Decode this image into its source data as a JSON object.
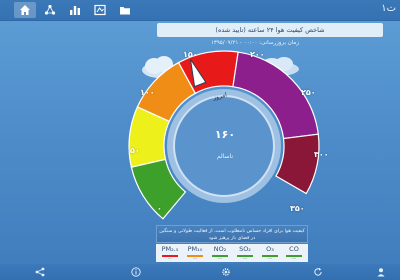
{
  "header": {
    "tabs": [
      {
        "icon": "home-icon",
        "active": true
      },
      {
        "icon": "network-icon",
        "active": false
      },
      {
        "icon": "bar-chart-icon",
        "active": false
      },
      {
        "icon": "map-icon",
        "active": false
      },
      {
        "icon": "folder-icon",
        "active": false
      }
    ],
    "menu_label": "ت۱"
  },
  "gauge": {
    "title": "شاخص کیفیت هوا ۲۴ ساعته (تایید شده)",
    "time_text": "زمان بروزرسانی: ۰۰:۰۰ - ۱۳۹۵/۰۹/۲۱",
    "ticks": [
      "۰",
      "۵۰",
      "۱۰۰",
      "۱۵۰",
      "۲۰۰",
      "۲۵۰",
      "۳۰۰",
      "۳۵۰"
    ],
    "today_label": "امروز",
    "value": "۱۶۰",
    "value_number": 160,
    "status": "ناسالم",
    "segment_colors": [
      "#3da02a",
      "#eef01c",
      "#ef8d16",
      "#e81919",
      "#8c1f8c",
      "#8a1737"
    ]
  },
  "info_text": "کیفیت هوا برای افراد حساس نامطلوب است، از فعالیت طولانی و سنگین در فضای باز پرهیز شود",
  "pollutants": [
    {
      "name": "PM₂.₅",
      "color": "#e81919",
      "value": "---"
    },
    {
      "name": "PM₁₀",
      "color": "#ef8d16",
      "value": "---"
    },
    {
      "name": "NO₂",
      "color": "#3da02a",
      "value": "---"
    },
    {
      "name": "SO₂",
      "color": "#3da02a",
      "value": "---"
    },
    {
      "name": "O₃",
      "color": "#3da02a",
      "value": "---"
    },
    {
      "name": "CO",
      "color": "#3da02a",
      "value": "---"
    }
  ],
  "bottom_bar": {
    "icons": [
      "share-icon",
      "info-icon",
      "settings-icon",
      "refresh-icon",
      "user-icon"
    ]
  }
}
